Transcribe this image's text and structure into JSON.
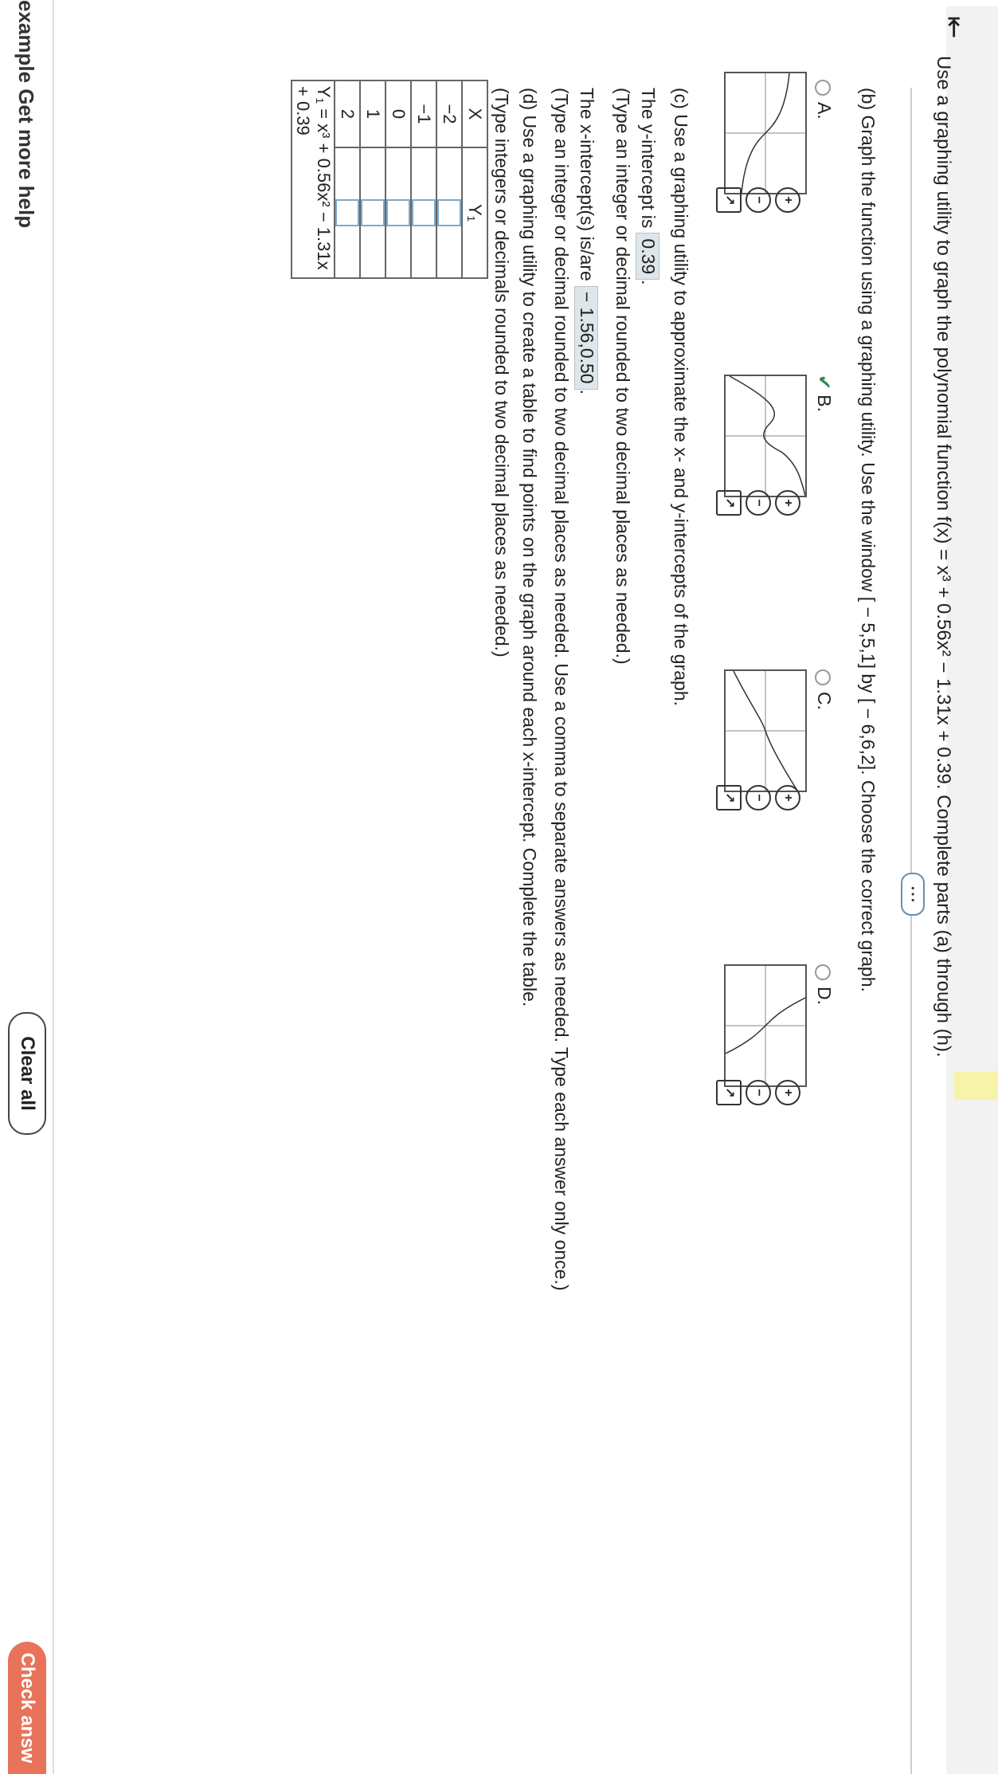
{
  "header": {
    "back_icon": "back-arrow-icon",
    "question": "Use a graphing utility to graph the polynomial function f(x) = x³ + 0.56x² − 1.31x + 0.39. Complete parts (a) through (h)."
  },
  "expand_dots": "• • •",
  "part_b": {
    "prompt": "(b) Graph the function using a graphing utility. Use the window [ − 5,5,1] by [ − 6,6,2]. Choose the correct graph.",
    "options": [
      {
        "letter": "A."
      },
      {
        "letter": "B.",
        "selected": true
      },
      {
        "letter": "C."
      },
      {
        "letter": "D."
      }
    ]
  },
  "part_c": {
    "prompt": "(c) Use a graphing utility to approximate the x- and y-intercepts of the graph.",
    "y_intercept_label": "The y-intercept is",
    "y_intercept_value": "0.39",
    "y_hint": "(Type an integer or decimal rounded to two decimal places as needed.)",
    "x_intercepts_label": "The x-intercept(s) is/are",
    "x_intercepts_value": "− 1.56,0.50",
    "x_hint": "(Type an integer or decimal rounded to two decimal places as needed. Use a comma to separate answers as needed. Type each answer only once.)"
  },
  "part_d": {
    "prompt": "(d) Use a graphing utility to create a table to find points on the graph around each x-intercept. Complete the table.",
    "hint": "(Type integers or decimals rounded to two decimal places as needed.)",
    "col_x": "X",
    "col_y": "Y₁",
    "rows": [
      "−2",
      "−1",
      "0",
      "1",
      "2"
    ],
    "footer": "Y₁ = x³ + 0.56x² − 1.31x + 0.39"
  },
  "footer": {
    "left_text": "example   Get more help",
    "clear_all": "Clear all",
    "check_answer": "Check answ"
  },
  "colors": {
    "selected_check": "#2e8b57",
    "check_button": "#e8735a",
    "answer_box": "#dfe6ea"
  }
}
